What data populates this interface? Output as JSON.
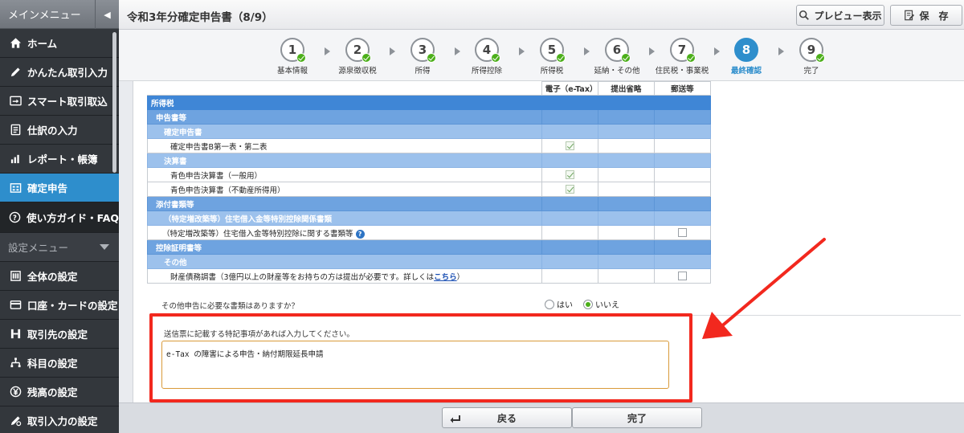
{
  "sidebar": {
    "title": "メインメニュー",
    "items": [
      {
        "label": "ホーム",
        "icon": "home-icon"
      },
      {
        "label": "かんたん取引入力",
        "icon": "pencil-icon"
      },
      {
        "label": "スマート取引取込",
        "icon": "import-icon"
      },
      {
        "label": "仕訳の入力",
        "icon": "journal-icon"
      },
      {
        "label": "レポート・帳簿",
        "icon": "report-icon"
      },
      {
        "label": "確定申告",
        "icon": "tax-return-icon",
        "active": true
      }
    ],
    "guide": "使い方ガイド・FAQ",
    "settings_title": "設定メニュー",
    "settings_items": [
      {
        "label": "全体の設定",
        "icon": "settings-icon"
      },
      {
        "label": "口座・カードの設定",
        "icon": "card-icon"
      },
      {
        "label": "取引先の設定",
        "icon": "partner-icon"
      },
      {
        "label": "科目の設定",
        "icon": "account-icon"
      },
      {
        "label": "残高の設定",
        "icon": "yen-icon"
      },
      {
        "label": "取引入力の設定",
        "icon": "input-settings-icon"
      }
    ]
  },
  "header": {
    "title": "令和3年分確定申告書（8/9）",
    "preview_label": "プレビュー表示",
    "save_label": "保　存"
  },
  "steps": [
    {
      "num": "1",
      "label": "基本情報",
      "done": true
    },
    {
      "num": "2",
      "label": "源泉徴収税",
      "done": true
    },
    {
      "num": "3",
      "label": "所得",
      "done": true
    },
    {
      "num": "4",
      "label": "所得控除",
      "done": true
    },
    {
      "num": "5",
      "label": "所得税",
      "done": true
    },
    {
      "num": "6",
      "label": "延納・その他",
      "done": true
    },
    {
      "num": "7",
      "label": "住民税・事業税",
      "done": true
    },
    {
      "num": "8",
      "label": "最終確認",
      "current": true
    },
    {
      "num": "9",
      "label": "完了",
      "done": true
    }
  ],
  "table": {
    "columns": [
      "電子（e-Tax）",
      "提出省略",
      "郵送等"
    ],
    "rows": [
      {
        "type": "lv0",
        "name": "所得税"
      },
      {
        "type": "lv1",
        "name": "申告書等"
      },
      {
        "type": "lv2",
        "name": "確定申告書"
      },
      {
        "type": "doc",
        "name": "確定申告書B第一表・第二表",
        "etax": true
      },
      {
        "type": "lv2",
        "name": "決算書"
      },
      {
        "type": "doc",
        "name": "青色申告決算書（一般用）",
        "etax": true
      },
      {
        "type": "doc",
        "name": "青色申告決算書（不動産所得用）",
        "etax": true
      },
      {
        "type": "lv1",
        "name": "添付書類等"
      },
      {
        "type": "lv2",
        "name": "（特定増改築等）住宅借入金等特別控除関係書類"
      },
      {
        "type": "doc",
        "name": "（特定増改築等）住宅借入金等特別控除に関する書類等",
        "mail": false,
        "help": true
      },
      {
        "type": "lv1",
        "name": "控除証明書等"
      },
      {
        "type": "lv2",
        "name": "その他"
      },
      {
        "type": "doc",
        "name": "財産債務調書（3億円以上の財産等をお持ちの方は提出が必要です。詳しくは",
        "link": "こちら",
        "tail": "）",
        "mail": false
      }
    ]
  },
  "other_docs": {
    "question": "その他申告に必要な書類はありますか？",
    "yes": "はい",
    "no": "いいえ",
    "selected": "no"
  },
  "notes": {
    "label": "送信票に記載する特記事項があれば入力してください。",
    "value": "e-Tax の障害による申告・納付期限延長申請"
  },
  "footer": {
    "back_label": "戻る",
    "done_label": "完了"
  },
  "colors": {
    "accent": "#2e8ecc",
    "highlight_border": "#f2281e",
    "check_green": "#4caf1a"
  }
}
